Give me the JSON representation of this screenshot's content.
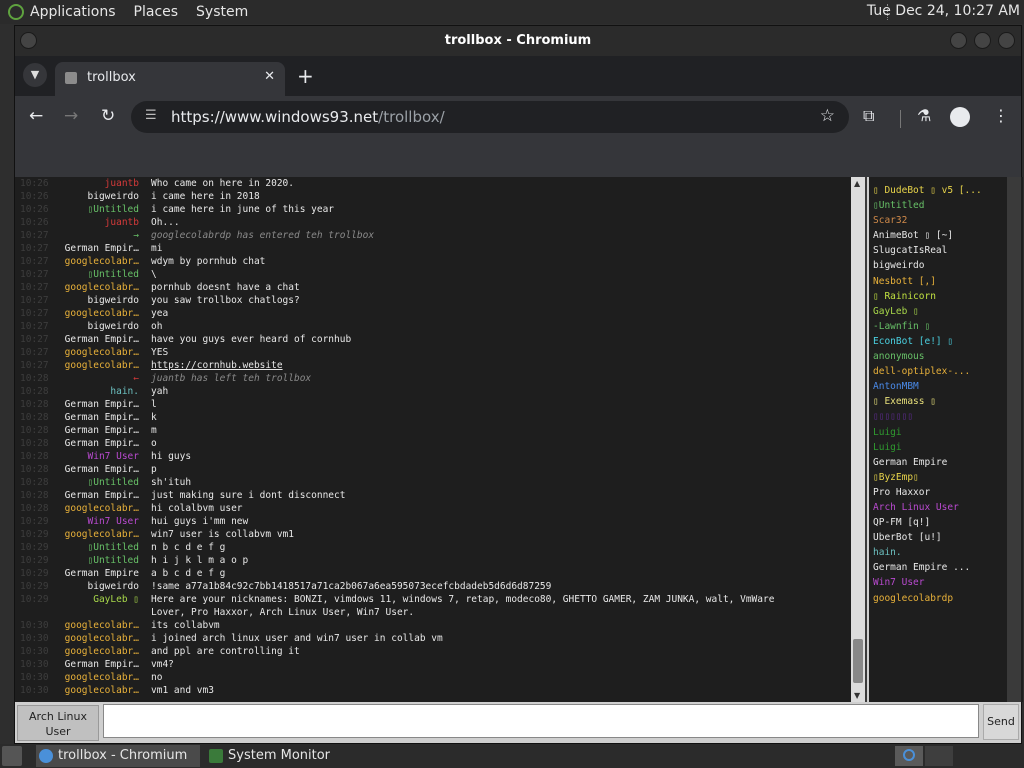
{
  "top_panel": {
    "menus": [
      "Applications",
      "Places",
      "System"
    ],
    "clock": "Tue Dec 24, 10:27 AM"
  },
  "window": {
    "title": "trollbox - Chromium"
  },
  "browser": {
    "tab_title": "trollbox",
    "tab_close": "✕",
    "new_tab": "+",
    "url_host": "https://www.windows93.net",
    "url_path": "/trollbox/"
  },
  "chat": {
    "messages": [
      {
        "time": "10:26",
        "nick": "juantb",
        "nick_color": "#d43a3a",
        "text": "Who came on here in 2020.",
        "sys": false
      },
      {
        "time": "10:26",
        "nick": "bigweirdo",
        "nick_color": "#e8e8e8",
        "text": "i came here in 2018",
        "sys": false
      },
      {
        "time": "10:26",
        "nick": "▯Untitled",
        "nick_color": "#67c067",
        "text": "i came here in june of this year",
        "sys": false
      },
      {
        "time": "10:26",
        "nick": "juantb",
        "nick_color": "#d43a3a",
        "text": "Oh...",
        "sys": false
      },
      {
        "time": "10:27",
        "nick": "→",
        "nick_color": "#67c067",
        "text": "googlecolabrdp has entered teh trollbox",
        "sys": true
      },
      {
        "time": "10:27",
        "nick": "German Empir…",
        "nick_color": "#e8e8e8",
        "text": "mi",
        "sys": false
      },
      {
        "time": "10:27",
        "nick": "googlecolabr…",
        "nick_color": "#e8b13a",
        "text": "wdym by pornhub chat",
        "sys": false
      },
      {
        "time": "10:27",
        "nick": "▯Untitled",
        "nick_color": "#67c067",
        "text": "\\",
        "sys": false
      },
      {
        "time": "10:27",
        "nick": "googlecolabr…",
        "nick_color": "#e8b13a",
        "text": "pornhub doesnt have a chat",
        "sys": false
      },
      {
        "time": "10:27",
        "nick": "bigweirdo",
        "nick_color": "#e8e8e8",
        "text": "you saw trollbox chatlogs?",
        "sys": false
      },
      {
        "time": "10:27",
        "nick": "googlecolabr…",
        "nick_color": "#e8b13a",
        "text": "yea",
        "sys": false
      },
      {
        "time": "10:27",
        "nick": "bigweirdo",
        "nick_color": "#e8e8e8",
        "text": "oh",
        "sys": false
      },
      {
        "time": "10:27",
        "nick": "German Empir…",
        "nick_color": "#e8e8e8",
        "text": "have you guys ever heard of cornhub",
        "sys": false
      },
      {
        "time": "10:27",
        "nick": "googlecolabr…",
        "nick_color": "#e8b13a",
        "text": "YES",
        "sys": false
      },
      {
        "time": "10:27",
        "nick": "googlecolabr…",
        "nick_color": "#e8b13a",
        "text": "https://cornhub.website",
        "sys": false,
        "link": true
      },
      {
        "time": "10:28",
        "nick": "←",
        "nick_color": "#d43a3a",
        "text": "juantb has left teh trollbox",
        "sys": true
      },
      {
        "time": "10:28",
        "nick": "hain.",
        "nick_color": "#6cc0c0",
        "text": "yah",
        "sys": false
      },
      {
        "time": "10:28",
        "nick": "German Empir…",
        "nick_color": "#e8e8e8",
        "text": "l",
        "sys": false
      },
      {
        "time": "10:28",
        "nick": "German Empir…",
        "nick_color": "#e8e8e8",
        "text": "k",
        "sys": false
      },
      {
        "time": "10:28",
        "nick": "German Empir…",
        "nick_color": "#e8e8e8",
        "text": "m",
        "sys": false
      },
      {
        "time": "10:28",
        "nick": "German Empir…",
        "nick_color": "#e8e8e8",
        "text": "o",
        "sys": false
      },
      {
        "time": "10:28",
        "nick": "Win7 User",
        "nick_color": "#b94ad0",
        "text": "hi guys",
        "sys": false
      },
      {
        "time": "10:28",
        "nick": "German Empir…",
        "nick_color": "#e8e8e8",
        "text": "p",
        "sys": false
      },
      {
        "time": "10:28",
        "nick": "▯Untitled",
        "nick_color": "#67c067",
        "text": "sh'ituh",
        "sys": false
      },
      {
        "time": "10:28",
        "nick": "German Empir…",
        "nick_color": "#e8e8e8",
        "text": "just making sure i dont disconnect",
        "sys": false
      },
      {
        "time": "10:28",
        "nick": "googlecolabr…",
        "nick_color": "#e8b13a",
        "text": "hi colalbvm user",
        "sys": false
      },
      {
        "time": "10:29",
        "nick": "Win7 User",
        "nick_color": "#b94ad0",
        "text": "hui guys i'mm new",
        "sys": false
      },
      {
        "time": "10:29",
        "nick": "googlecolabr…",
        "nick_color": "#e8b13a",
        "text": "win7 user is collabvm vm1",
        "sys": false
      },
      {
        "time": "10:29",
        "nick": "▯Untitled",
        "nick_color": "#67c067",
        "text": "n b c d e f g",
        "sys": false
      },
      {
        "time": "10:29",
        "nick": "▯Untitled",
        "nick_color": "#67c067",
        "text": "h i j k l m a o p",
        "sys": false
      },
      {
        "time": "10:29",
        "nick": "German Empire",
        "nick_color": "#e8e8e8",
        "text": "a b c d e f g",
        "sys": false
      },
      {
        "time": "10:29",
        "nick": "bigweirdo",
        "nick_color": "#e8e8e8",
        "text": "!same a77a1b84c92c7bb1418517a71ca2b067a6ea595073ecefcbdadeb5d6d6d87259",
        "sys": false
      },
      {
        "time": "10:29",
        "nick": "GayLeb ▯",
        "nick_color": "#a8d84a",
        "text": "Here are your nicknames: BONZI, vimdows 11, windows 7, retap, modeco80, GHETTO GAMER, ZAM JUNKA, walt, VmWare",
        "sys": false
      },
      {
        "time": "",
        "nick": "",
        "nick_color": "#e8e8e8",
        "text": "Lover, Pro Haxxor, Arch Linux User, Win7 User.",
        "sys": false
      },
      {
        "time": "10:30",
        "nick": "googlecolabr…",
        "nick_color": "#e8b13a",
        "text": "its collabvm",
        "sys": false
      },
      {
        "time": "10:30",
        "nick": "googlecolabr…",
        "nick_color": "#e8b13a",
        "text": "i joined arch linux user and win7 user in collab vm",
        "sys": false
      },
      {
        "time": "10:30",
        "nick": "googlecolabr…",
        "nick_color": "#e8b13a",
        "text": "and ppl are controlling it",
        "sys": false
      },
      {
        "time": "10:30",
        "nick": "German Empir…",
        "nick_color": "#e8e8e8",
        "text": "vm4?",
        "sys": false
      },
      {
        "time": "10:30",
        "nick": "googlecolabr…",
        "nick_color": "#e8b13a",
        "text": "no",
        "sys": false
      },
      {
        "time": "10:30",
        "nick": "googlecolabr…",
        "nick_color": "#e8b13a",
        "text": "vm1 and vm3",
        "sys": false
      }
    ]
  },
  "users": [
    {
      "name": "▯ DudeBot ▯ v5 [...",
      "color": "#e8d44a"
    },
    {
      "name": "▯Untitled",
      "color": "#67c067"
    },
    {
      "name": "Scar32",
      "color": "#d08a4a"
    },
    {
      "name": "AnimeBot ▯ [~]",
      "color": "#e8e8e8"
    },
    {
      "name": "SlugcatIsReal",
      "color": "#e8e8e8"
    },
    {
      "name": "bigweirdo",
      "color": "#e8e8e8"
    },
    {
      "name": "Nesbott [,]",
      "color": "#e8b13a"
    },
    {
      "name": "▯ Rainicorn",
      "color": "#c0e040"
    },
    {
      "name": "GayLeb ▯",
      "color": "#a8d84a"
    },
    {
      "name": "-Lawnfin ▯",
      "color": "#67c067"
    },
    {
      "name": "EconBot [e!] ▯",
      "color": "#4ad0e0"
    },
    {
      "name": "anonymous",
      "color": "#67c067"
    },
    {
      "name": "dell-optiplex-...",
      "color": "#e8b13a"
    },
    {
      "name": "AntonMBM",
      "color": "#4a8ae8"
    },
    {
      "name": "▯ Exemass ▯",
      "color": "#e8e07a"
    },
    {
      "name": "▯▯▯▯▯▯▯",
      "color": "#5a2a8a"
    },
    {
      "name": "Luigi",
      "color": "#2f9a2f"
    },
    {
      "name": "Luigi",
      "color": "#2f9a2f"
    },
    {
      "name": "German Empire",
      "color": "#e8e8e8"
    },
    {
      "name": "▯ByzEmp▯",
      "color": "#e8d44a"
    },
    {
      "name": "Pro Haxxor",
      "color": "#e8e8e8"
    },
    {
      "name": "Arch Linux User",
      "color": "#b94ad0"
    },
    {
      "name": "QP-FM [q!]",
      "color": "#e8e8e8"
    },
    {
      "name": "UberBot [u!]",
      "color": "#e8e8e8"
    },
    {
      "name": "hain.",
      "color": "#6cc0c0"
    },
    {
      "name": "German Empire ...",
      "color": "#e8e8e8"
    },
    {
      "name": "Win7 User",
      "color": "#b94ad0"
    },
    {
      "name": "googlecolabrdp",
      "color": "#e8b13a"
    }
  ],
  "input": {
    "nick_line1": "Arch Linux",
    "nick_line2": "User",
    "value": "",
    "send_label": "Send"
  },
  "taskbar": {
    "tasks": [
      "trollbox - Chromium",
      "System Monitor"
    ]
  },
  "colors": {
    "accent": "#4a90d9"
  }
}
